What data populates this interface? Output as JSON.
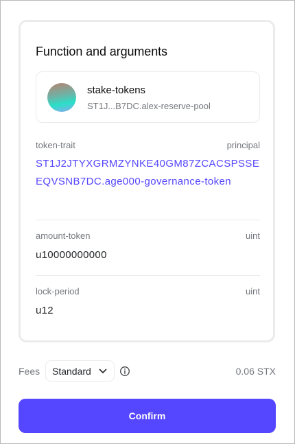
{
  "function_panel": {
    "title": "Function and arguments",
    "contract": {
      "name": "stake-tokens",
      "address": "ST1J...B7DC.alex-reserve-pool",
      "avatar_icon": "contract-avatar-gradient"
    },
    "arguments": [
      {
        "name": "token-trait",
        "type": "principal",
        "value": "ST1J2JTYXGRMZYNKE40GM87ZCACSPSSEEQVSNB7DC.age000-governance-token"
      },
      {
        "name": "amount-token",
        "type": "uint",
        "value": "u10000000000"
      },
      {
        "name": "lock-period",
        "type": "uint",
        "value": "u12"
      }
    ]
  },
  "fees": {
    "label": "Fees",
    "selected_option": "Standard",
    "amount": "0.06 STX",
    "info_icon": "info-icon",
    "dropdown_icon": "chevron-down-icon"
  },
  "confirm_button": {
    "label": "Confirm"
  },
  "colors": {
    "accent": "#5546ff",
    "muted_text": "#74777d",
    "border": "#ebebed"
  }
}
